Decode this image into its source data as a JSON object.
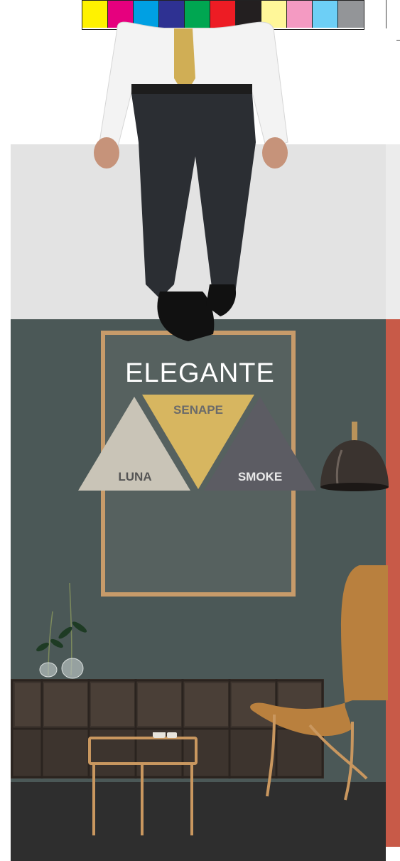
{
  "swatches": [
    "#fff200",
    "#e6007e",
    "#00a0e3",
    "#2e3192",
    "#00a651",
    "#ed1c24",
    "#231f20",
    "#fff799",
    "#f49ac2",
    "#6dcff6",
    "#939598"
  ],
  "colors": {
    "wall": "#4b5857",
    "frame": "#c79b6a",
    "luna": "#c9c4b7",
    "senape": "#d7b660",
    "smoke": "#5c5c63",
    "accent_wall": "#c85a48"
  },
  "palette": {
    "title": "ELEGANTE",
    "swatches": [
      {
        "name": "LUNA"
      },
      {
        "name": "SENAPE"
      },
      {
        "name": "SMOKE"
      }
    ]
  }
}
